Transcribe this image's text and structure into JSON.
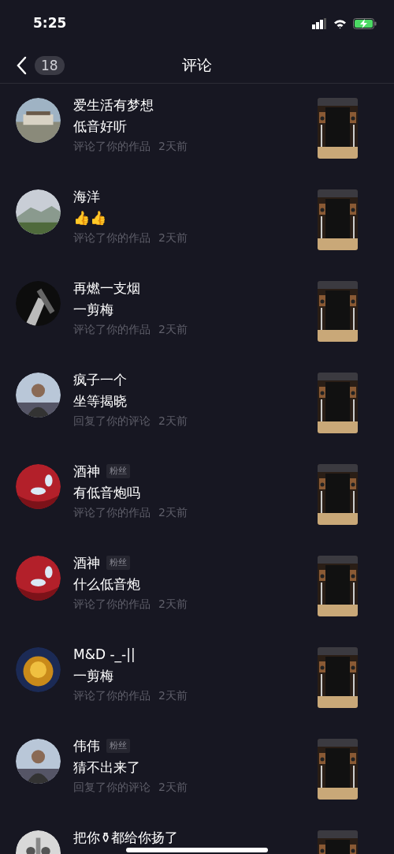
{
  "status_bar": {
    "time": "5:25"
  },
  "nav": {
    "count": "18",
    "title": "评论"
  },
  "items": [
    {
      "name": "爱生活有梦想",
      "comment": "低音好听",
      "action": "评论了你的作品",
      "time": "2天前"
    },
    {
      "name": "海洋",
      "comment": "👍👍",
      "action": "评论了你的作品",
      "time": "2天前"
    },
    {
      "name": "再燃一支烟",
      "comment": "一剪梅",
      "action": "评论了你的作品",
      "time": "2天前"
    },
    {
      "name": "疯子一个",
      "comment": "坐等揭晓",
      "action": "回复了你的评论",
      "time": "2天前"
    },
    {
      "name": "酒神",
      "badge": "粉丝",
      "comment": "有低音炮吗",
      "action": "评论了你的作品",
      "time": "2天前"
    },
    {
      "name": "酒神",
      "badge": "粉丝",
      "comment": "什么低音炮",
      "action": "评论了你的作品",
      "time": "2天前"
    },
    {
      "name": "M&D -_-||",
      "comment": "一剪梅",
      "action": "评论了你的作品",
      "time": "2天前"
    },
    {
      "name": "伟伟",
      "badge": "粉丝",
      "comment": "猜不出来了",
      "action": "回复了你的评论",
      "time": "2天前"
    },
    {
      "name": "把你⚱都给你扬了"
    }
  ]
}
